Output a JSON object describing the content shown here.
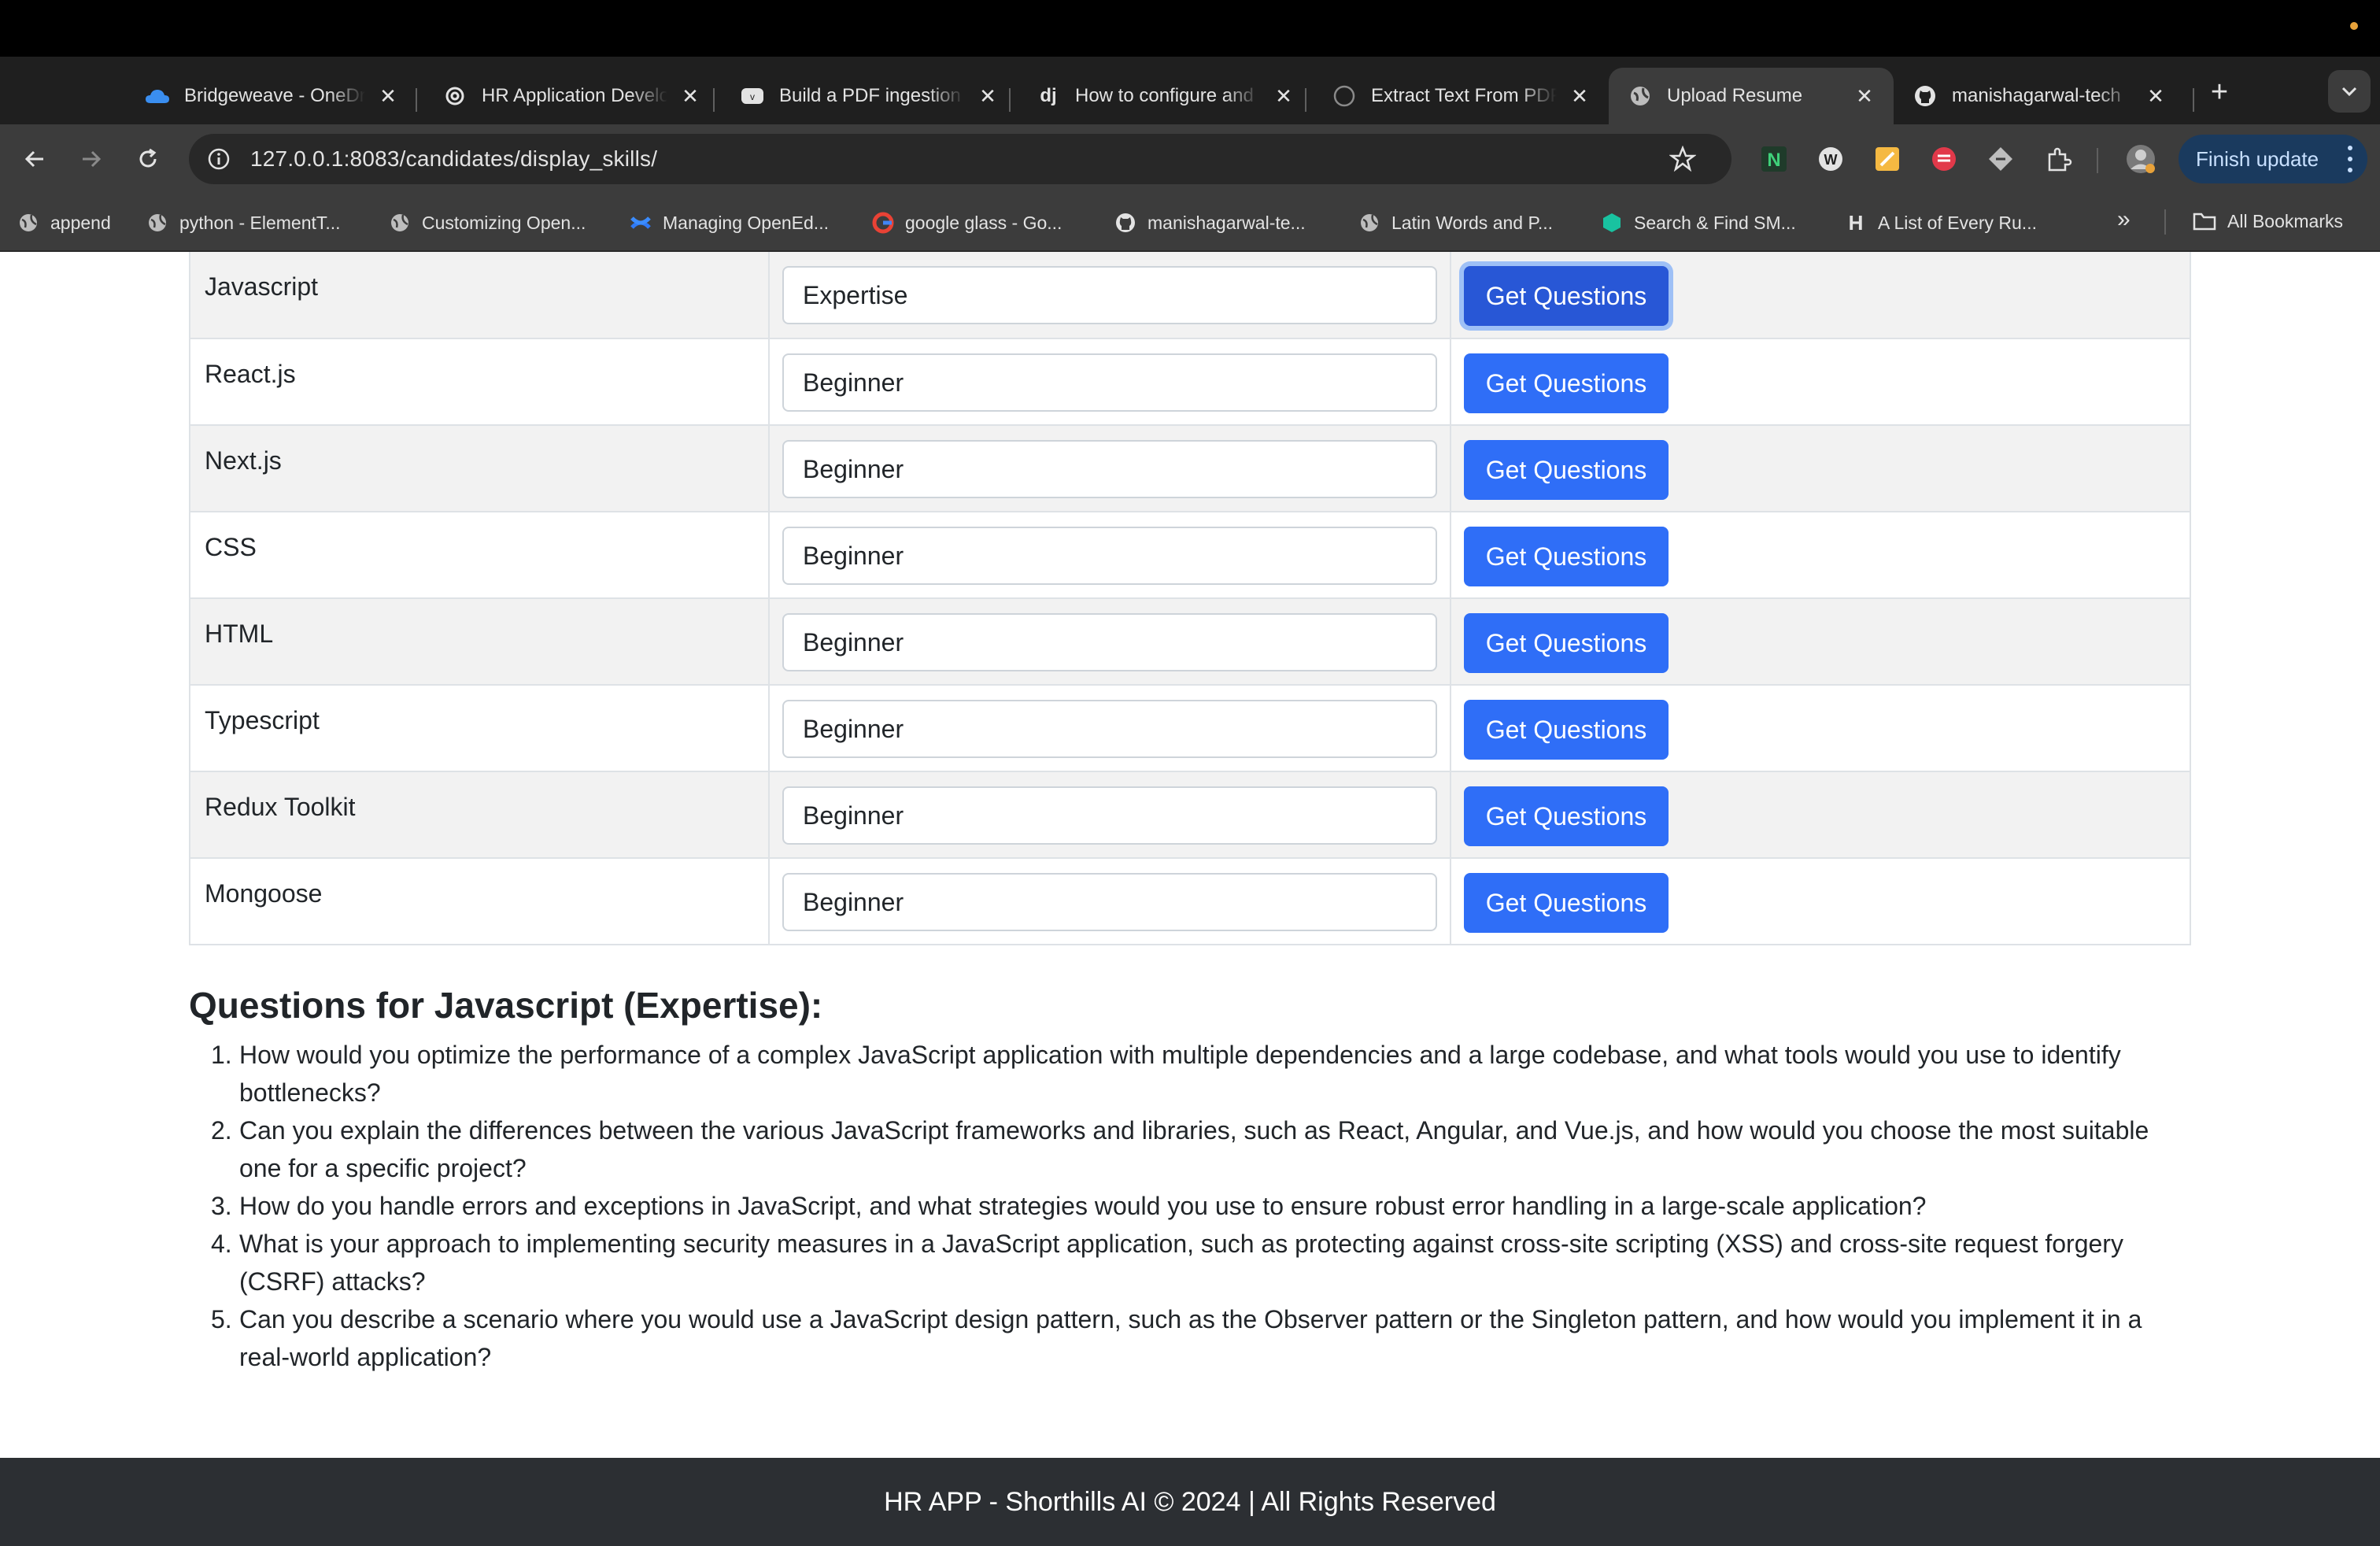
{
  "browser": {
    "tabs": [
      {
        "title": "Bridgeweave - OneDrive",
        "icon": "onedrive-icon"
      },
      {
        "title": "HR Application Development",
        "icon": "openai-icon"
      },
      {
        "title": "Build a PDF ingestion",
        "icon": "vimeo-icon"
      },
      {
        "title": "How to configure and",
        "icon": "django-icon"
      },
      {
        "title": "Extract Text From PDF",
        "icon": "generic-site-icon"
      },
      {
        "title": "Upload Resume",
        "icon": "globe-icon",
        "active": true
      },
      {
        "title": "manishagarwal-tech",
        "icon": "github-icon"
      }
    ],
    "url": "127.0.0.1:8083/candidates/display_skills/",
    "finish_update_label": "Finish update",
    "bookmarks": [
      {
        "label": "append",
        "icon": "globe-icon"
      },
      {
        "label": "python - ElementT...",
        "icon": "globe-icon"
      },
      {
        "label": "Customizing Open...",
        "icon": "globe-icon"
      },
      {
        "label": "Managing OpenEd...",
        "icon": "confluence-icon"
      },
      {
        "label": "google glass - Go...",
        "icon": "google-icon"
      },
      {
        "label": "manishagarwal-te...",
        "icon": "github-icon"
      },
      {
        "label": "Latin Words and P...",
        "icon": "globe-icon"
      },
      {
        "label": "Search & Find SM...",
        "icon": "hexagon-icon"
      },
      {
        "label": "A List of Every Ru...",
        "icon": "h-icon"
      }
    ],
    "more_bookmarks": "»",
    "all_bookmarks_label": "All Bookmarks"
  },
  "skills": {
    "button_label": "Get Questions",
    "rows": [
      {
        "skill": "Javascript",
        "level": "Expertise"
      },
      {
        "skill": "React.js",
        "level": "Beginner"
      },
      {
        "skill": "Next.js",
        "level": "Beginner"
      },
      {
        "skill": "CSS",
        "level": "Beginner"
      },
      {
        "skill": "HTML",
        "level": "Beginner"
      },
      {
        "skill": "Typescript",
        "level": "Beginner"
      },
      {
        "skill": "Redux Toolkit",
        "level": "Beginner"
      },
      {
        "skill": "Mongoose",
        "level": "Beginner"
      }
    ]
  },
  "questions": {
    "heading": "Questions for Javascript (Expertise):",
    "items": [
      "How would you optimize the performance of a complex JavaScript application with multiple dependencies and a large codebase, and what tools would you use to identify bottlenecks?",
      "Can you explain the differences between the various JavaScript frameworks and libraries, such as React, Angular, and Vue.js, and how would you choose the most suitable one for a specific project?",
      "How do you handle errors and exceptions in JavaScript, and what strategies would you use to ensure robust error handling in a large-scale application?",
      "What is your approach to implementing security measures in a JavaScript application, such as protecting against cross-site scripting (XSS) and cross-site request forgery (CSRF) attacks?",
      "Can you describe a scenario where you would use a JavaScript design pattern, such as the Observer pattern or the Singleton pattern, and how would you implement it in a real-world application?"
    ]
  },
  "footer": {
    "text": "HR APP - Shorthills AI © 2024 | All Rights Reserved"
  },
  "colors": {
    "primary_button": "#2f6ef7",
    "footer_bg": "#2c2f33",
    "chrome_bg": "#3c3c3c"
  }
}
